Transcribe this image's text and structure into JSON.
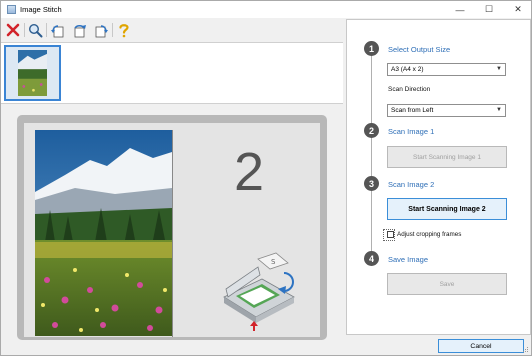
{
  "window": {
    "title": "Image Stitch",
    "minimize_glyph": "—",
    "maximize_glyph": "☐",
    "close_glyph": "✕"
  },
  "toolbar": {
    "icons": [
      "delete-icon",
      "zoom-icon",
      "rotate-left-icon",
      "rotate-180-icon",
      "rotate-right-icon",
      "help-icon"
    ]
  },
  "preview": {
    "big_number": "2"
  },
  "panel": {
    "step1": {
      "number": "1",
      "title": "Select Output Size",
      "output_size": "A3 (A4 x 2)",
      "scan_direction_label": "Scan Direction",
      "scan_direction": "Scan from Left"
    },
    "step2": {
      "number": "2",
      "title": "Scan Image 1",
      "button": "Start Scanning Image 1"
    },
    "step3": {
      "number": "3",
      "title": "Scan Image 2",
      "button": "Start Scanning Image 2",
      "checkbox_label": "Adjust cropping frames"
    },
    "step4": {
      "number": "4",
      "title": "Save Image",
      "button": "Save"
    }
  },
  "footer": {
    "cancel_label": "Cancel"
  },
  "colors": {
    "accent": "#2f6fb7",
    "active_button_border": "#3b8ed8",
    "step_circle": "#555555"
  }
}
